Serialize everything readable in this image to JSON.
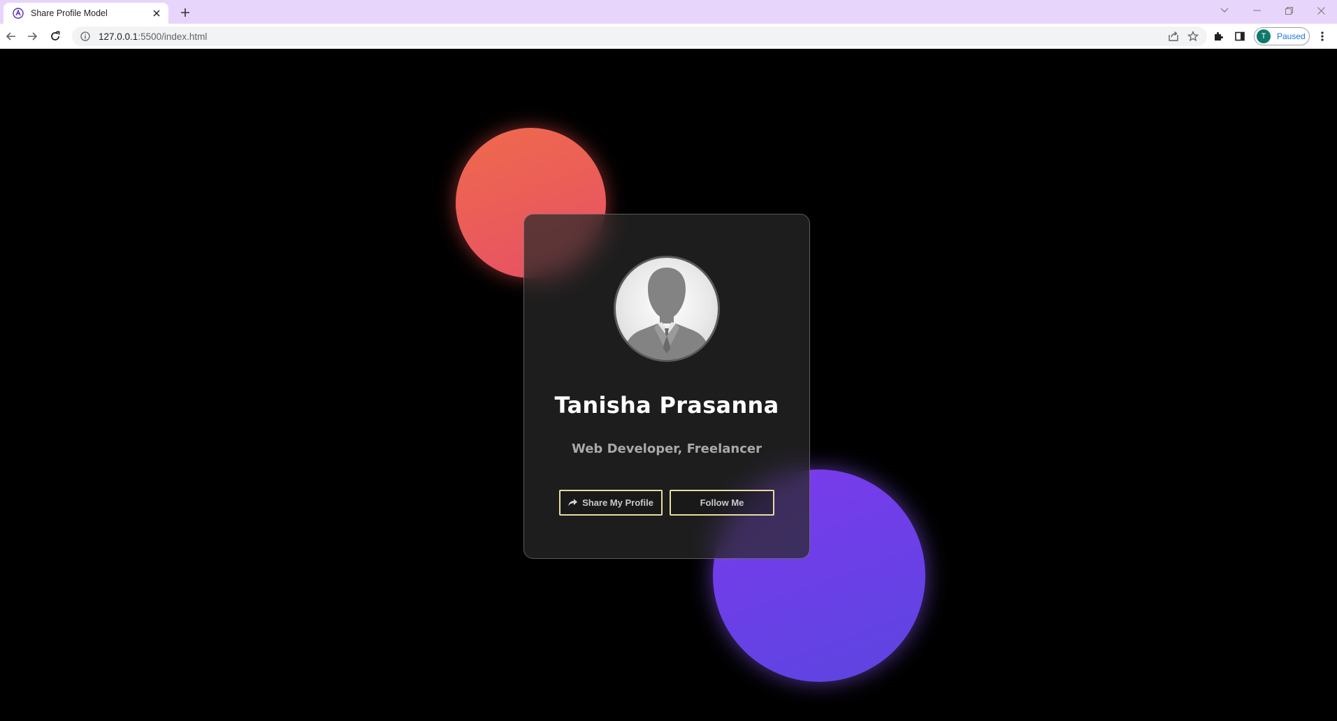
{
  "browser": {
    "tab_title": "Share Profile Model",
    "url_host": "127.0.0.1",
    "url_rest": ":5500/index.html",
    "profile_initial": "T",
    "profile_status": "Paused"
  },
  "icons": {
    "favicon": "tab-favicon-icon",
    "close": "close-icon",
    "new_tab": "plus-icon",
    "back": "back-arrow-icon",
    "forward": "forward-arrow-icon",
    "reload": "reload-icon",
    "site_info": "info-icon",
    "share_page": "share-page-icon",
    "bookmark": "star-icon",
    "extensions": "puzzle-icon",
    "side_panel": "side-panel-icon",
    "menu": "kebab-menu-icon",
    "share_button": "share-arrow-icon"
  },
  "card": {
    "name": "Tanisha Prasanna",
    "role": "Web Developer, Freelancer",
    "share_button_label": "Share My Profile",
    "follow_button_label": "Follow Me"
  },
  "colors": {
    "page_background": "#000000",
    "red_blob": "#e8585b",
    "purple_blob": "#6c3fe8",
    "button_border": "#e8dca0",
    "tab_strip": "#e8d5fb"
  }
}
